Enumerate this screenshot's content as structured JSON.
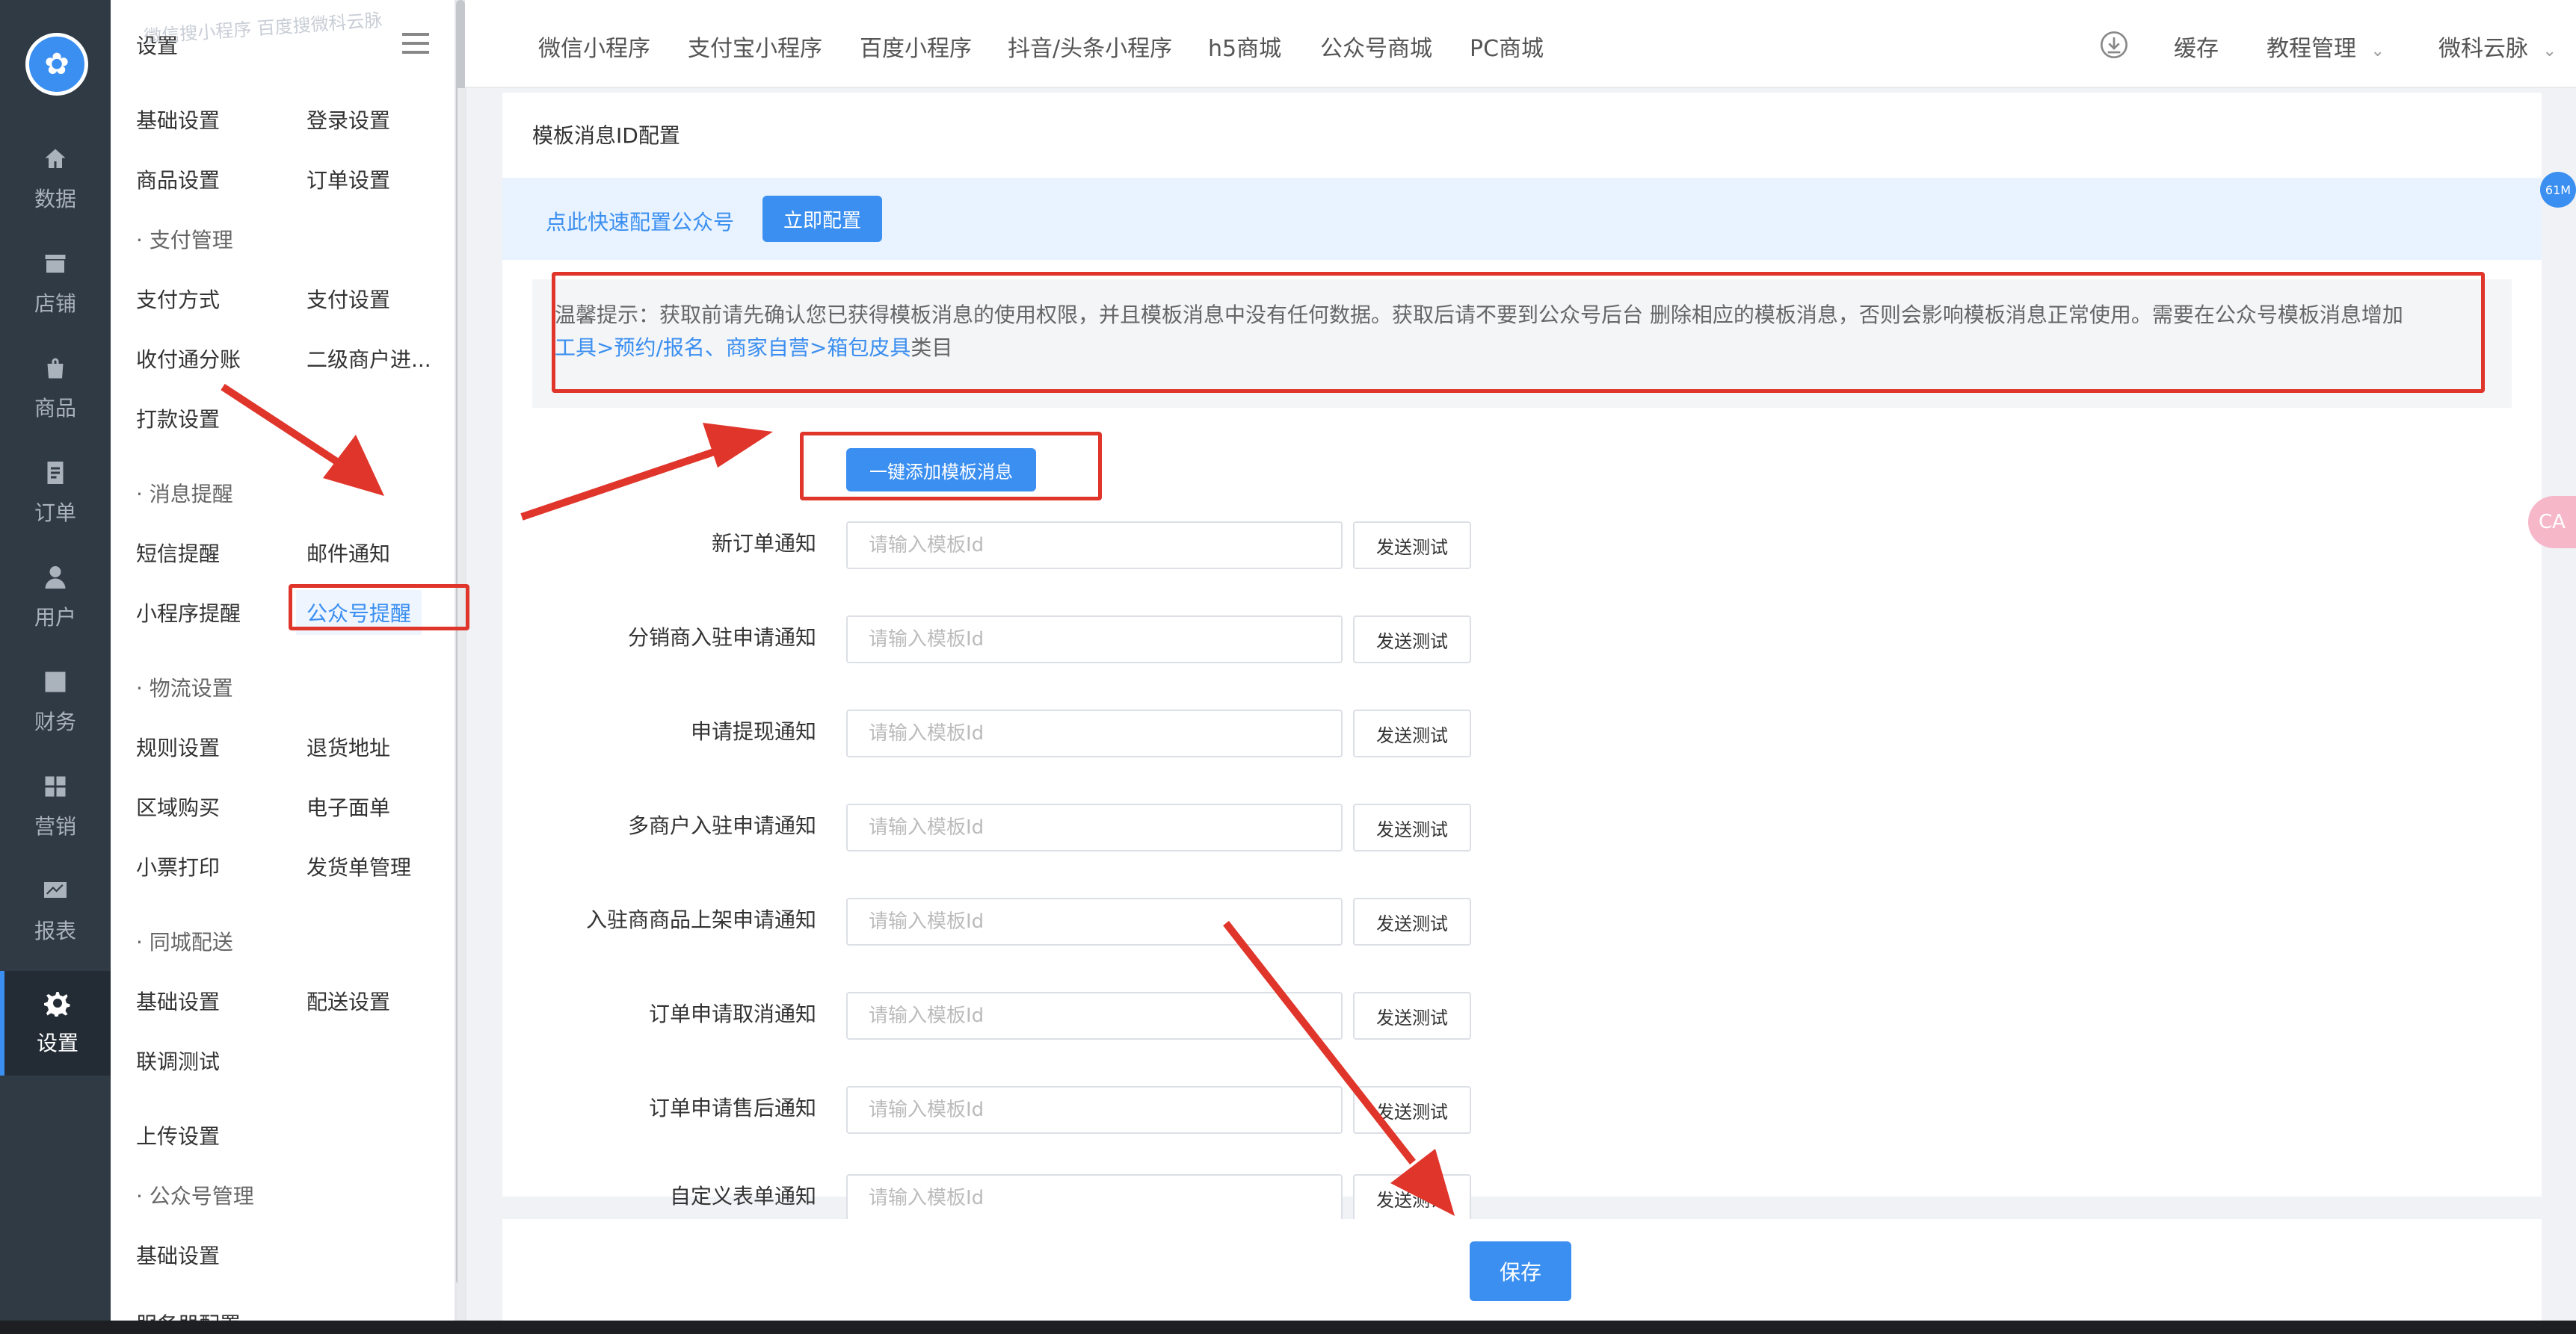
{
  "sidebar_rail": {
    "logo_icon": "app-logo-icon",
    "items": [
      {
        "label": "数据",
        "icon": "home-icon"
      },
      {
        "label": "店铺",
        "icon": "store-icon"
      },
      {
        "label": "商品",
        "icon": "bag-icon"
      },
      {
        "label": "订单",
        "icon": "order-icon"
      },
      {
        "label": "用户",
        "icon": "user-icon"
      },
      {
        "label": "财务",
        "icon": "finance-icon"
      },
      {
        "label": "营销",
        "icon": "grid-icon"
      },
      {
        "label": "报表",
        "icon": "chart-icon"
      },
      {
        "label": "设置",
        "icon": "gear-icon"
      }
    ],
    "active": "设置"
  },
  "subnav": {
    "title": "设置",
    "watermark": "微信搜小程序 百度搜微科云脉",
    "links": {
      "basic": "基础设置",
      "login": "登录设置",
      "goods": "商品设置",
      "order": "订单设置",
      "pay_method": "支付方式",
      "pay_setting": "支付设置",
      "split": "收付通分账",
      "secondary_merchant": "二级商户进...",
      "payout": "打款设置",
      "sms": "短信提醒",
      "email": "邮件通知",
      "miniprogram": "小程序提醒",
      "official_account": "公众号提醒",
      "rules": "规则设置",
      "return_address": "退货地址",
      "region": "区域购买",
      "e_waybill": "电子面单",
      "receipt": "小票打印",
      "delivery_note": "发货单管理",
      "city_basic": "基础设置",
      "dispatch": "配送设置",
      "joint_test": "联调测试",
      "upload": "上传设置",
      "oa_basic": "基础设置",
      "server_partial": "服务器配置"
    },
    "groups": {
      "payment": "· 支付管理",
      "message": "· 消息提醒",
      "logistics": "· 物流设置",
      "city": "· 同城配送",
      "official": "· 公众号管理"
    }
  },
  "topnav": {
    "tabs": [
      "微信小程序",
      "支付宝小程序",
      "百度小程序",
      "抖音/头条小程序",
      "h5商城",
      "公众号商城",
      "PC商城"
    ],
    "cache": "缓存",
    "tutorial": "教程管理",
    "user": "微科云脉"
  },
  "page": {
    "title": "模板消息ID配置",
    "quick_config_text": "点此快速配置公众号",
    "quick_config_button": "立即配置",
    "tip_prefix": "温馨提示：获取前请先确认您已获得模板消息的使用权限，并且模板消息中没有任何数据。获取后请不要到公众号后台 删除相应的模板消息，否则会影响模板消息正常使用。需要在公众号模板消息增加",
    "tip_link": "工具>预约/报名、商家自营>箱包皮具",
    "tip_suffix": "类目",
    "one_click_button": "一键添加模板消息",
    "input_placeholder": "请输入模板Id",
    "test_button": "发送测试",
    "fields": [
      {
        "label": "新订单通知",
        "value": ""
      },
      {
        "label": "分销商入驻申请通知",
        "value": ""
      },
      {
        "label": "申请提现通知",
        "value": ""
      },
      {
        "label": "多商户入驻申请通知",
        "value": ""
      },
      {
        "label": "入驻商商品上架申请通知",
        "value": ""
      },
      {
        "label": "订单申请取消通知",
        "value": ""
      },
      {
        "label": "订单申请售后通知",
        "value": ""
      },
      {
        "label": "自定义表单通知",
        "value": ""
      }
    ],
    "save_button": "保存"
  },
  "floating": {
    "memory_badge": "61M",
    "translate_badge": "CA"
  },
  "annotations": {
    "color": "#e0352b"
  },
  "colors": {
    "accent": "#3b8ff0",
    "rail": "#2f3a45"
  }
}
